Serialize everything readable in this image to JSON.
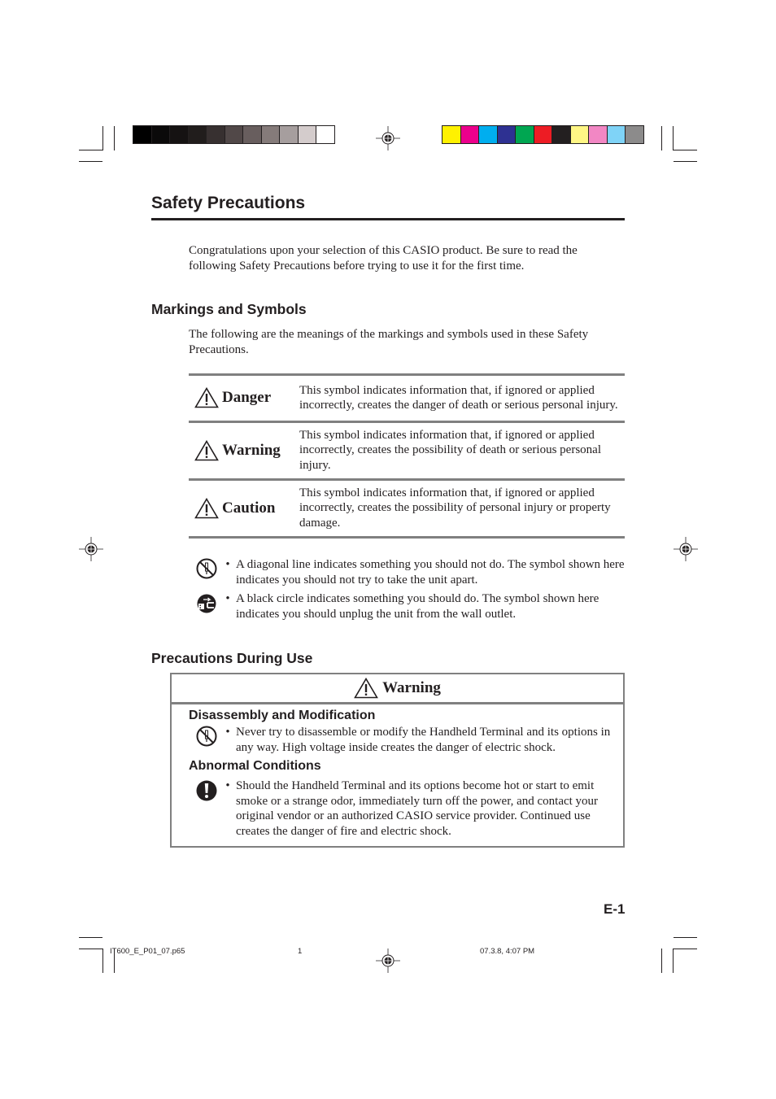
{
  "printer_marks": {
    "grayscale_swatches": [
      "#000000",
      "#0b0a0a",
      "#151212",
      "#211d1c",
      "#373030",
      "#514848",
      "#685e5e",
      "#857b7a",
      "#a69e9e",
      "#d4cccc",
      "#ffffff"
    ],
    "color_swatches": [
      "#fff100",
      "#ec008c",
      "#00aeef",
      "#2e3192",
      "#00a651",
      "#ed1c24",
      "#231f20",
      "#fff685",
      "#f287c4",
      "#7fd3f7",
      "#8c8b8b"
    ]
  },
  "page": {
    "title": "Safety Precautions",
    "intro": "Congratulations upon your selection of this CASIO product. Be sure to read the following Safety Precautions before trying to use it for the first time.",
    "markings": {
      "heading": "Markings and Symbols",
      "description": "The following are the meanings of the markings and symbols used in these Safety Precautions.",
      "levels": [
        {
          "label": "Danger",
          "icon": "warning-triangle-icon",
          "text": "This symbol indicates information that, if ignored or applied incorrectly, creates the danger of death or serious personal injury."
        },
        {
          "label": "Warning",
          "icon": "warning-triangle-icon",
          "text": "This symbol indicates information that, if ignored or applied incorrectly, creates the possibility of death or serious personal injury."
        },
        {
          "label": "Caution",
          "icon": "warning-triangle-icon",
          "text": "This symbol indicates information that, if ignored or applied incorrectly, creates the possibility of personal injury or property damage."
        }
      ],
      "symbols": [
        {
          "icon": "no-disassembly-icon",
          "bullet": "•",
          "text": "A diagonal line indicates something you should not do. The symbol shown here indicates you should not try to take the unit apart."
        },
        {
          "icon": "unplug-icon",
          "bullet": "•",
          "text": "A black circle indicates something you should do. The symbol shown here indicates you should unplug the unit from the wall outlet."
        }
      ]
    },
    "precautions": {
      "heading": "Precautions During Use",
      "box_title": "Warning",
      "sections": [
        {
          "heading": "Disassembly and Modification",
          "icon": "no-disassembly-icon",
          "bullet": "•",
          "text": "Never try to disassemble or modify the Handheld Terminal and its options in any way. High voltage inside creates the danger of electric shock."
        },
        {
          "heading": "Abnormal Conditions",
          "icon": "exclamation-circle-icon",
          "bullet": "•",
          "text": "Should the Handheld Terminal and its options become hot or start to emit smoke or a strange odor, immediately turn off the power, and contact your original vendor or an authorized CASIO service provider. Continued use creates the danger of fire and electric shock."
        }
      ]
    },
    "page_number": "E-1"
  },
  "footer": {
    "filename": "IT600_E_P01_07.p65",
    "sheet": "1",
    "timestamp": "07.3.8, 4:07 PM"
  }
}
